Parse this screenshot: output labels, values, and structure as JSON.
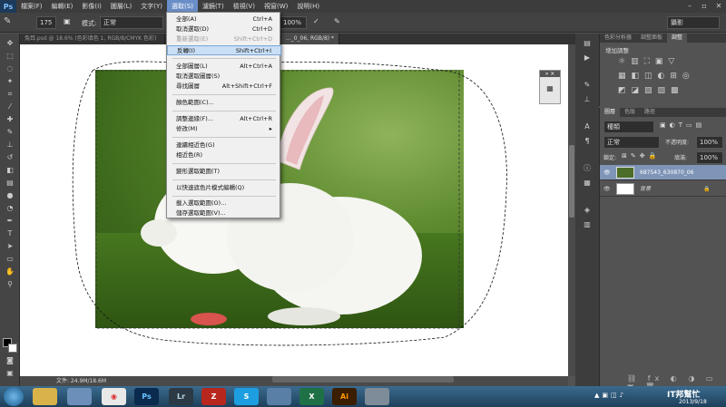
{
  "app": {
    "logo": "Ps"
  },
  "menubar": [
    "檔案(F)",
    "編輯(E)",
    "影像(I)",
    "圖層(L)",
    "文字(Y)",
    "選取(S)",
    "濾鏡(T)",
    "檢視(V)",
    "視窗(W)",
    "說明(H)"
  ],
  "options": {
    "brush_size": "175",
    "mode_label": "模式:",
    "mode_value": "正常",
    "percent": "100%",
    "workspace": "攝影"
  },
  "doc_tabs": [
    "兔耳.psd @ 18.6% (色彩填色 1, RGB/8/CMYK 色彩)",
    "..._0_06, RGB/8) *"
  ],
  "status": {
    "doc_size": "文件: 24.9M/18.6M"
  },
  "select_menu": {
    "items": [
      {
        "label": "全部(A)",
        "shortcut": "Ctrl+A",
        "disabled": false
      },
      {
        "label": "取消選取(D)",
        "shortcut": "Ctrl+D",
        "disabled": false
      },
      {
        "label": "重新選取(E)",
        "shortcut": "Shift+Ctrl+D",
        "disabled": true
      },
      {
        "label": "反轉(I)",
        "shortcut": "Shift+Ctrl+I",
        "disabled": false,
        "highlighted": true
      },
      {
        "label": "全部圖層(L)",
        "shortcut": "Alt+Ctrl+A",
        "disabled": false
      },
      {
        "label": "取消選取圖層(S)",
        "shortcut": "",
        "disabled": false
      },
      {
        "label": "尋找圖層",
        "shortcut": "Alt+Shift+Ctrl+F",
        "disabled": false
      },
      {
        "label": "顏色範圍(C)...",
        "shortcut": "",
        "disabled": false
      },
      {
        "label": "調整邊緣(F)...",
        "shortcut": "Alt+Ctrl+R",
        "disabled": false
      },
      {
        "label": "修改(M)",
        "shortcut": "▸",
        "disabled": false
      },
      {
        "label": "連續相近色(G)",
        "shortcut": "",
        "disabled": false
      },
      {
        "label": "相近色(R)",
        "shortcut": "",
        "disabled": false
      },
      {
        "label": "變形選取範圍(T)",
        "shortcut": "",
        "disabled": false
      },
      {
        "label": "以快速遮色片模式編輯(Q)",
        "shortcut": "",
        "disabled": false
      },
      {
        "label": "載入選取範圍(O)...",
        "shortcut": "",
        "disabled": false
      },
      {
        "label": "儲存選取範圍(V)...",
        "shortcut": "",
        "disabled": false
      }
    ]
  },
  "panels": {
    "adj_tabs": [
      "色彩分析器",
      "調整面板",
      "調整"
    ],
    "adj_title": "增加調整",
    "layer_tabs": [
      "圖層",
      "色版",
      "路徑"
    ],
    "kind": "種類",
    "blend": "正常",
    "opacity_label": "不透明度:",
    "opacity": "100%",
    "lock_label": "鎖定:",
    "fill_label": "填滿:",
    "fill": "100%",
    "layers": [
      {
        "name": "687543_630870_06",
        "selected": true
      },
      {
        "name": "背景",
        "selected": false
      }
    ]
  },
  "taskbar": {
    "apps": [
      "Ps",
      "Lr",
      "Ai"
    ],
    "clock_date": "2013/9/18",
    "watermark": "IT邦幫忙"
  }
}
